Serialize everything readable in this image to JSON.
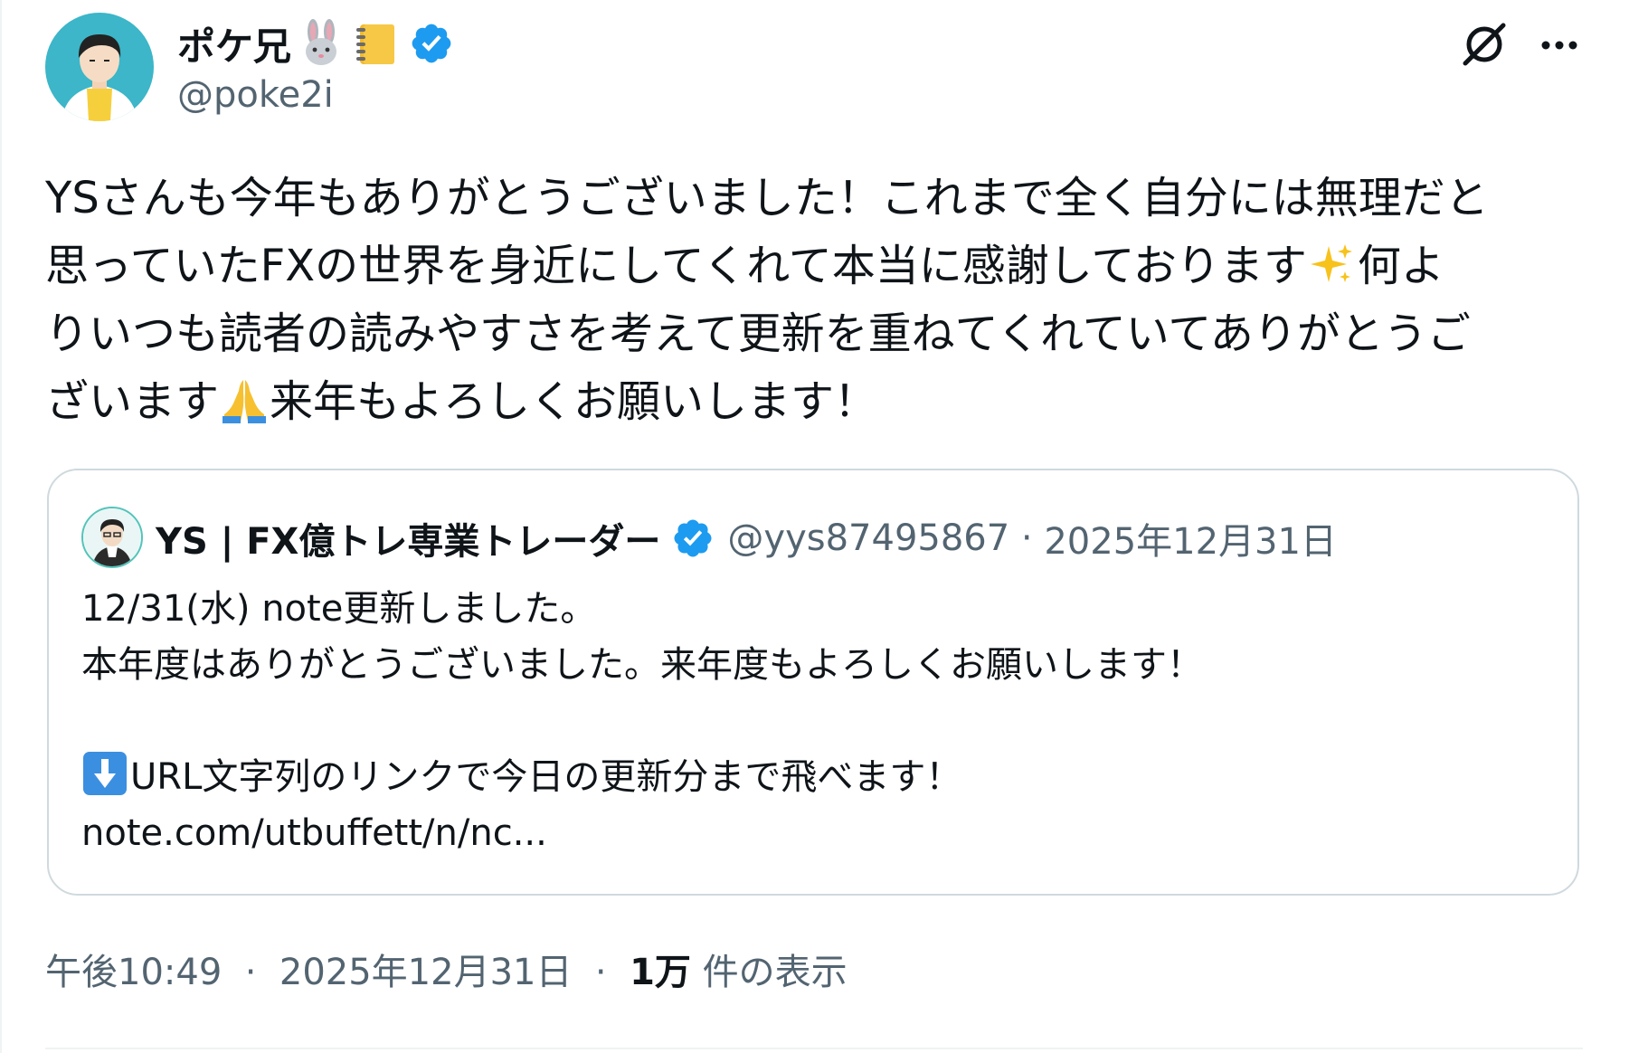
{
  "author": {
    "display_name": "ポケ兄",
    "handle": "@poke2i",
    "emoji_icons": [
      "rabbit-face-icon",
      "notebook-icon"
    ],
    "verified": true
  },
  "tweet": {
    "lines": [
      "YSさんも今年もありがとうございました！これまで全く自分には無理だと",
      "思っていたFXの世界を身近にしてくれて本当に感謝しております",
      "何よ",
      "りいつも読者の読みやすさを考えて更新を重ねてくれていてありがとうご",
      "ざいます",
      "来年もよろしくお願いします！"
    ],
    "inline_emojis": [
      "sparkles-icon",
      "folded-hands-icon"
    ]
  },
  "quote": {
    "display_name": "YS | FX億トレ専業トレーダー",
    "handle": "@yys87495867",
    "separator": "·",
    "date": "2025年12月31日",
    "lines": [
      "12/31(水) note更新しました。",
      "本年度はありがとうございました。来年度もよろしくお願いします！",
      "",
      "URL文字列のリンクで今日の更新分まで飛べます！",
      "note.com/utbuffett/n/nc..."
    ],
    "inline_emoji": "down-arrow-icon"
  },
  "footer": {
    "time": "午後10:49",
    "separator": "·",
    "date": "2025年12月31日",
    "views_count": "1万",
    "views_label": "件の表示"
  },
  "colors": {
    "text": "#0f1419",
    "secondary": "#536471",
    "verified": "#1d9bf0",
    "border": "#cfd9de"
  }
}
